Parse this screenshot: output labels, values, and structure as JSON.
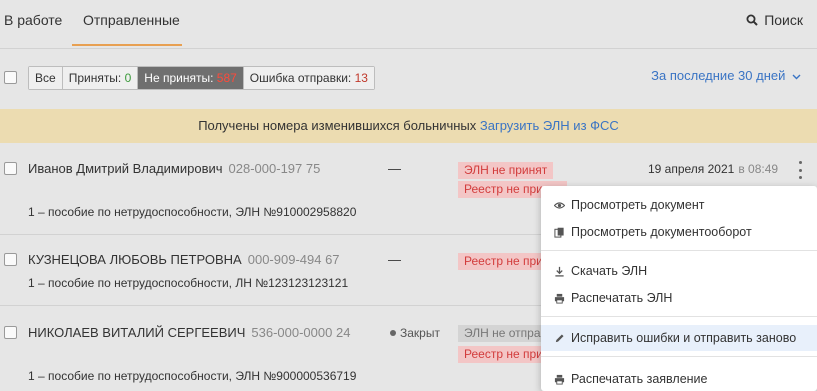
{
  "tabs": {
    "in_work": "В работе",
    "sent": "Отправленные"
  },
  "search": {
    "label": "Поиск",
    "icon": "search-icon"
  },
  "filters": {
    "all": "Все",
    "accepted_label": "Приняты: ",
    "accepted_count": "0",
    "not_accepted_label": "Не приняты: ",
    "not_accepted_count": "587",
    "error_label": "Ошибка отправки: ",
    "error_count": "13"
  },
  "period": {
    "label": "За последние 30 дней",
    "icon": "chevron-down-icon"
  },
  "banner": {
    "text": "Получены номера изменившихся больничных ",
    "link": "Загрузить ЭЛН из ФСС"
  },
  "rows": [
    {
      "name": "Иванов Дмитрий Владимирович",
      "snils": "028-000-197 75",
      "desc": "1 – пособие по нетрудоспособности, ЭЛН №910002958820",
      "status_mark": "—",
      "tag1": "ЭЛН не принят",
      "tag2": "Реестр не принят",
      "date": "19 апреля 2021",
      "time": "в 08:49"
    },
    {
      "name": "КУЗНЕЦОВА ЛЮБОВЬ ПЕТРОВНА",
      "snils": "000-909-494 67",
      "desc": "1 – пособие по нетрудоспособности, ЛН №123123123121",
      "status_mark": "—",
      "tag1": "Реестр не принят"
    },
    {
      "name": "НИКОЛАЕВ ВИТАЛИЙ СЕРГЕЕВИЧ",
      "snils": "536-000-0000 24",
      "desc": "1 – пособие по нетрудоспособности, ЭЛН №900000536719",
      "status_mark": "Закрыт",
      "tag1": "ЭЛН не отправлен",
      "tag2": "Реестр не принят"
    }
  ],
  "menu": {
    "view_doc": "Просмотреть документ",
    "view_flow": "Просмотреть документооборот",
    "download": "Скачать ЭЛН",
    "print": "Распечатать ЭЛН",
    "fix_resend": "Исправить ошибки и отправить заново",
    "print_app": "Распечатать заявление"
  },
  "colors": {
    "accent": "#e8a052",
    "link": "#3a74c4",
    "banner": "#ecdcb1",
    "error": "#d23c3c"
  }
}
